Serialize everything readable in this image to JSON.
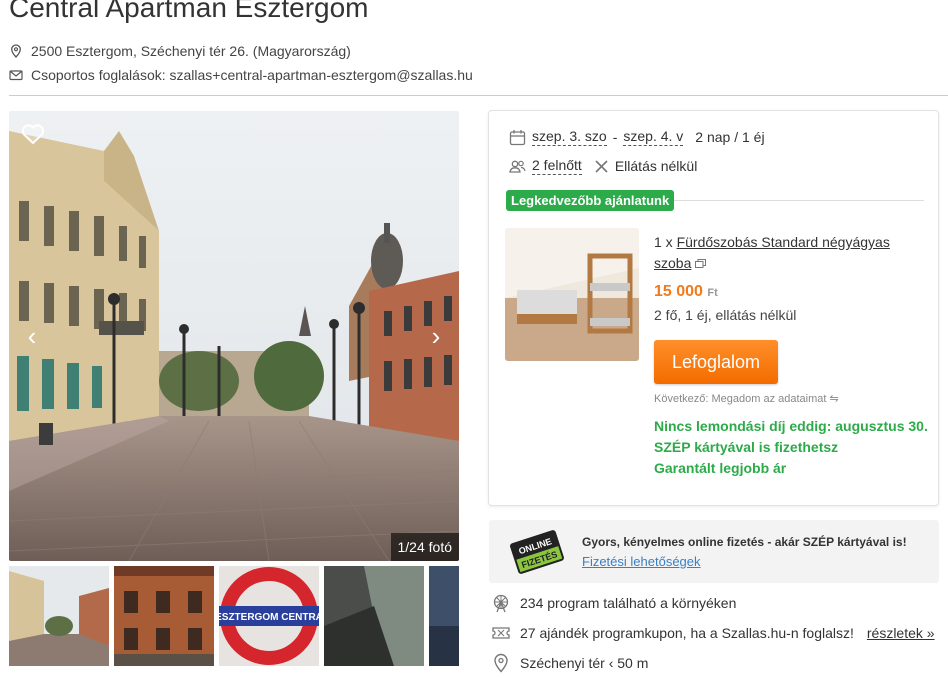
{
  "property": {
    "title": "Central Apartman Esztergom",
    "address": "2500 Esztergom, Széchenyi tér 26. (Magyarország)",
    "group_booking": "Csoportos foglalások: szallas+central-apartman-esztergom@szallas.hu"
  },
  "gallery": {
    "counter": "1/24 fotó",
    "thumb_sign_text": "ESZTERGOM CENTRA"
  },
  "search": {
    "checkin": "szep. 3. szo",
    "separator": "-",
    "checkout": "szep. 4. v",
    "nights": "2 nap / 1 éj",
    "guests": "2 felnőtt",
    "board": "Ellátás nélkül"
  },
  "offer": {
    "badge": "Legkedvezőbb ajánlatunk",
    "quantity": "1 x",
    "room_name": "Fürdőszobás Standard négyágyas szoba",
    "price": "15 000",
    "currency": "Ft",
    "details": "2 fő, 1 éj, ellátás nélkül",
    "book_label": "Lefoglalom",
    "next_note": "Következő: Megadom az adataimat",
    "perks": [
      "Nincs lemondási díj eddig: augusztus 30.",
      "SZÉP kártyával is fizethetsz",
      "Garantált legjobb ár"
    ]
  },
  "payment": {
    "logo_line1": "ONLINE",
    "logo_line2": "FIZETÉS",
    "title": "Gyors, kényelmes online fizetés - akár SZÉP kártyával is!",
    "link": "Fizetési lehetőségek"
  },
  "info": {
    "programs": "234 program található a környéken",
    "coupons": "27 ajándék programkupon, ha a Szallas.hu-n foglalsz!",
    "coupons_more": "részletek »",
    "nearby": "Széchenyi tér ‹ 50 m"
  },
  "colors": {
    "accent_orange": "#f27a1a",
    "green": "#2daa4a",
    "link_blue": "#3a7fc4"
  }
}
